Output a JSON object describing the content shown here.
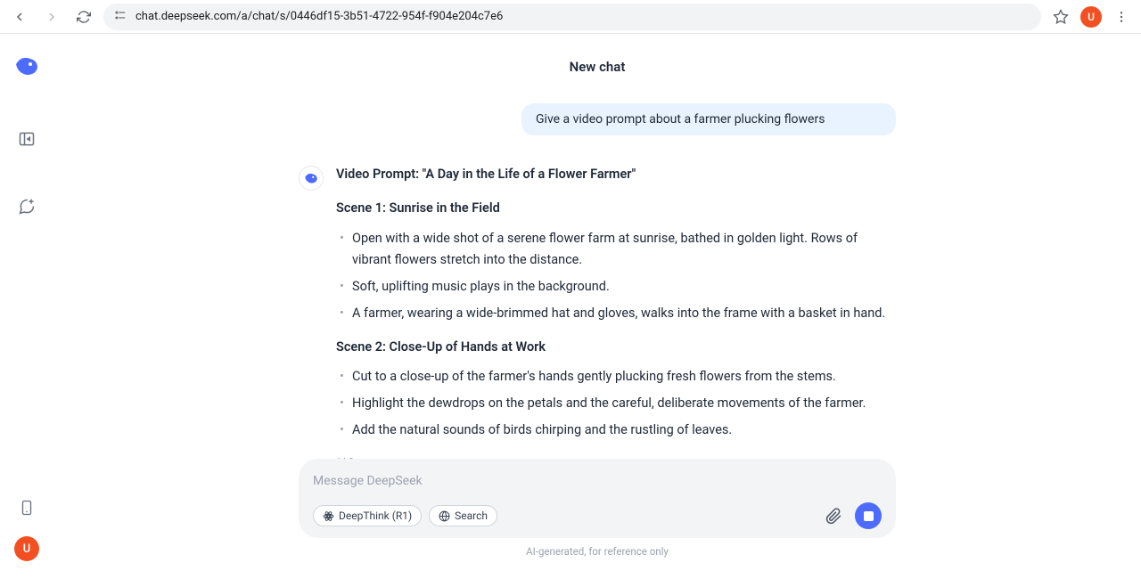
{
  "browser": {
    "url": "chat.deepseek.com/a/chat/s/0446df15-3b51-4722-954f-f904e204c7e6",
    "avatar_letter": "U"
  },
  "sidebar": {
    "avatar_letter": "U"
  },
  "chat": {
    "title": "New chat",
    "user_message": "Give a video prompt about a farmer plucking flowers",
    "response": {
      "heading": "Video Prompt: \"A Day in the Life of a Flower Farmer\"",
      "scene1_title": "Scene 1: Sunrise in the Field",
      "scene1_items": [
        "Open with a wide shot of a serene flower farm at sunrise, bathed in golden light. Rows of vibrant flowers stretch into the distance.",
        "Soft, uplifting music plays in the background.",
        "A farmer, wearing a wide-brimmed hat and gloves, walks into the frame with a basket in hand."
      ],
      "scene2_title": "Scene 2: Close-Up of Hands at Work",
      "scene2_items": [
        "Cut to a close-up of the farmer's hands gently plucking fresh flowers from the stems.",
        "Highlight the dewdrops on the petals and the careful, deliberate movements of the farmer.",
        "Add the natural sounds of birds chirping and the rustling of leaves."
      ],
      "partial": "**Scene"
    }
  },
  "input": {
    "placeholder": "Message DeepSeek",
    "deepthink_label": "DeepThink (R1)",
    "search_label": "Search"
  },
  "disclaimer": "AI-generated, for reference only"
}
